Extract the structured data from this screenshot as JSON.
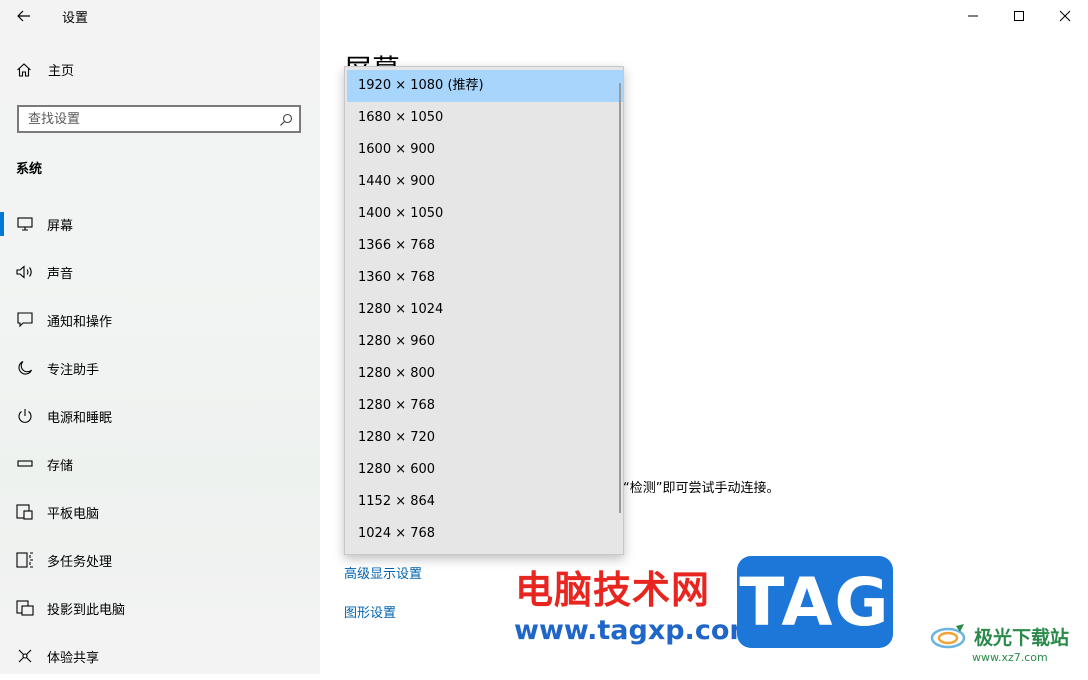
{
  "window": {
    "title": "设置",
    "controls": {
      "minimize": "minimize-icon",
      "maximize": "maximize-icon",
      "close": "close-icon"
    }
  },
  "sidebar": {
    "home_label": "主页",
    "search_placeholder": "查找设置",
    "section_label": "系统",
    "items": [
      {
        "label": "屏幕",
        "icon": "monitor-icon",
        "active": true
      },
      {
        "label": "声音",
        "icon": "speaker-icon",
        "active": false
      },
      {
        "label": "通知和操作",
        "icon": "notification-icon",
        "active": false
      },
      {
        "label": "专注助手",
        "icon": "moon-icon",
        "active": false
      },
      {
        "label": "电源和睡眠",
        "icon": "power-icon",
        "active": false
      },
      {
        "label": "存储",
        "icon": "storage-icon",
        "active": false
      },
      {
        "label": "平板电脑",
        "icon": "tablet-icon",
        "active": false
      },
      {
        "label": "多任务处理",
        "icon": "multitask-icon",
        "active": false
      },
      {
        "label": "投影到此电脑",
        "icon": "project-icon",
        "active": false
      },
      {
        "label": "体验共享",
        "icon": "share-icon",
        "active": false
      }
    ]
  },
  "main": {
    "page_title": "屏幕",
    "detect_text": "“检测”即可尝试手动连接。",
    "advanced_link": "高级显示设置",
    "graphics_link": "图形设置"
  },
  "resolution_dropdown": {
    "selected": "1920 × 1080 (推荐)",
    "options": [
      "1920 × 1080 (推荐)",
      "1680 × 1050",
      "1600 × 900",
      "1440 × 900",
      "1400 × 1050",
      "1366 × 768",
      "1360 × 768",
      "1280 × 1024",
      "1280 × 960",
      "1280 × 800",
      "1280 × 768",
      "1280 × 720",
      "1280 × 600",
      "1152 × 864",
      "1024 × 768"
    ]
  },
  "watermark": {
    "site_name": "电脑技术网",
    "url": "www.tagxp.com",
    "badge": "TAG",
    "brand2": "极光下载站",
    "brand2_url": "www.xz7.com"
  },
  "colors": {
    "accent": "#0078d7",
    "selected_option": "#a8d5fb",
    "link": "#0063b1",
    "watermark_red": "#e8261f",
    "watermark_blue": "#1c77d8"
  }
}
